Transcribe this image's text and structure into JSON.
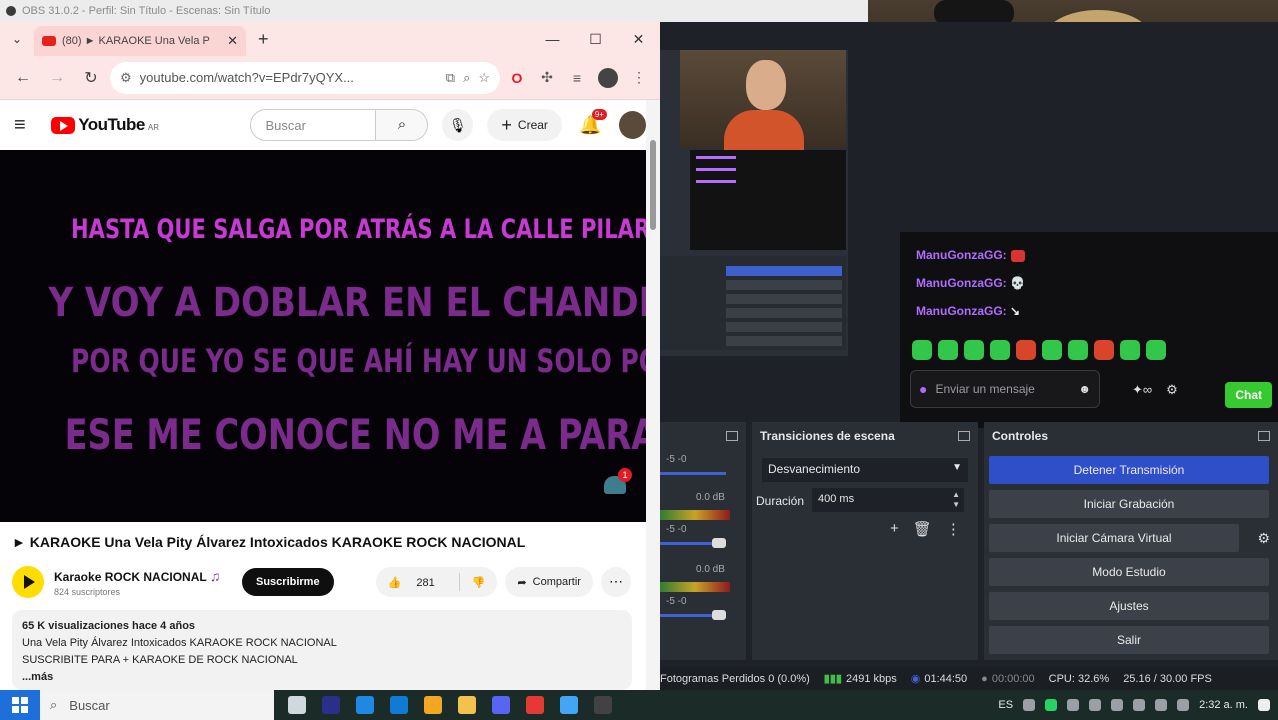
{
  "obs_title": "OBS 31.0.2 - Perfil: Sin Título - Escenas: Sin Título",
  "browser": {
    "tab_title": "(80) ► KARAOKE Una Vela P",
    "url": "youtube.com/watch?v=EPdr7yQYX..."
  },
  "youtube": {
    "logo_text": "YouTube",
    "logo_country": "AR",
    "search_placeholder": "Buscar",
    "create_label": "Crear",
    "notification_count": "9+",
    "lyrics": [
      "HASTA QUE SALGA POR ATRÁS A LA CALLE PILAR",
      "Y VOY A DOBLAR EN EL CHANDIA",
      "POR QUE YO SE QUE AHÍ HAY UN SOLO POLICÍA",
      "ESE ME CONOCE NO ME A PARAR"
    ],
    "player_notification_count": "1",
    "video_title": "► KARAOKE Una Vela Pity Álvarez Intoxicados KARAOKE ROCK NACIONAL",
    "channel_name": "Karaoke ROCK NACIONAL",
    "channel_subscribers": "824 suscriptores",
    "subscribe_label": "Suscribirme",
    "likes": "281",
    "share_label": "Compartir",
    "description_meta": "65 K visualizaciones  hace 4 años",
    "description_line1": "Una Vela Pity Álvarez Intoxicados KARAOKE ROCK NACIONAL",
    "description_line2": "SUSCRIBITE PARA + KARAOKE DE ROCK NACIONAL",
    "description_more": "...más"
  },
  "chat": {
    "user": "ManuGonzaGG:",
    "input_placeholder": "Enviar un mensaje",
    "chat_button": "Chat"
  },
  "obs": {
    "mixer_levels": [
      "0.0 dB",
      "0.0 dB"
    ],
    "transitions_title": "Transiciones de escena",
    "transition_value": "Desvanecimiento",
    "duration_label": "Duración",
    "duration_value": "400 ms",
    "controls_title": "Controles",
    "controls": {
      "stop_stream": "Detener Transmisión",
      "start_recording": "Iniciar Grabación",
      "start_virtual_cam": "Iniciar Cámara Virtual",
      "studio_mode": "Modo Estudio",
      "settings": "Ajustes",
      "exit": "Salir"
    },
    "status": {
      "dropped_frames": "Fotogramas Perdidos 0 (0.0%)",
      "bitrate": "2491 kbps",
      "stream_time": "01:44:50",
      "rec_time": "00:00:00",
      "cpu": "CPU: 32.6%",
      "fps": "25.16 / 30.00 FPS"
    }
  },
  "taskbar": {
    "search_placeholder": "Buscar",
    "language": "ES",
    "time": "2:32 a. m."
  }
}
